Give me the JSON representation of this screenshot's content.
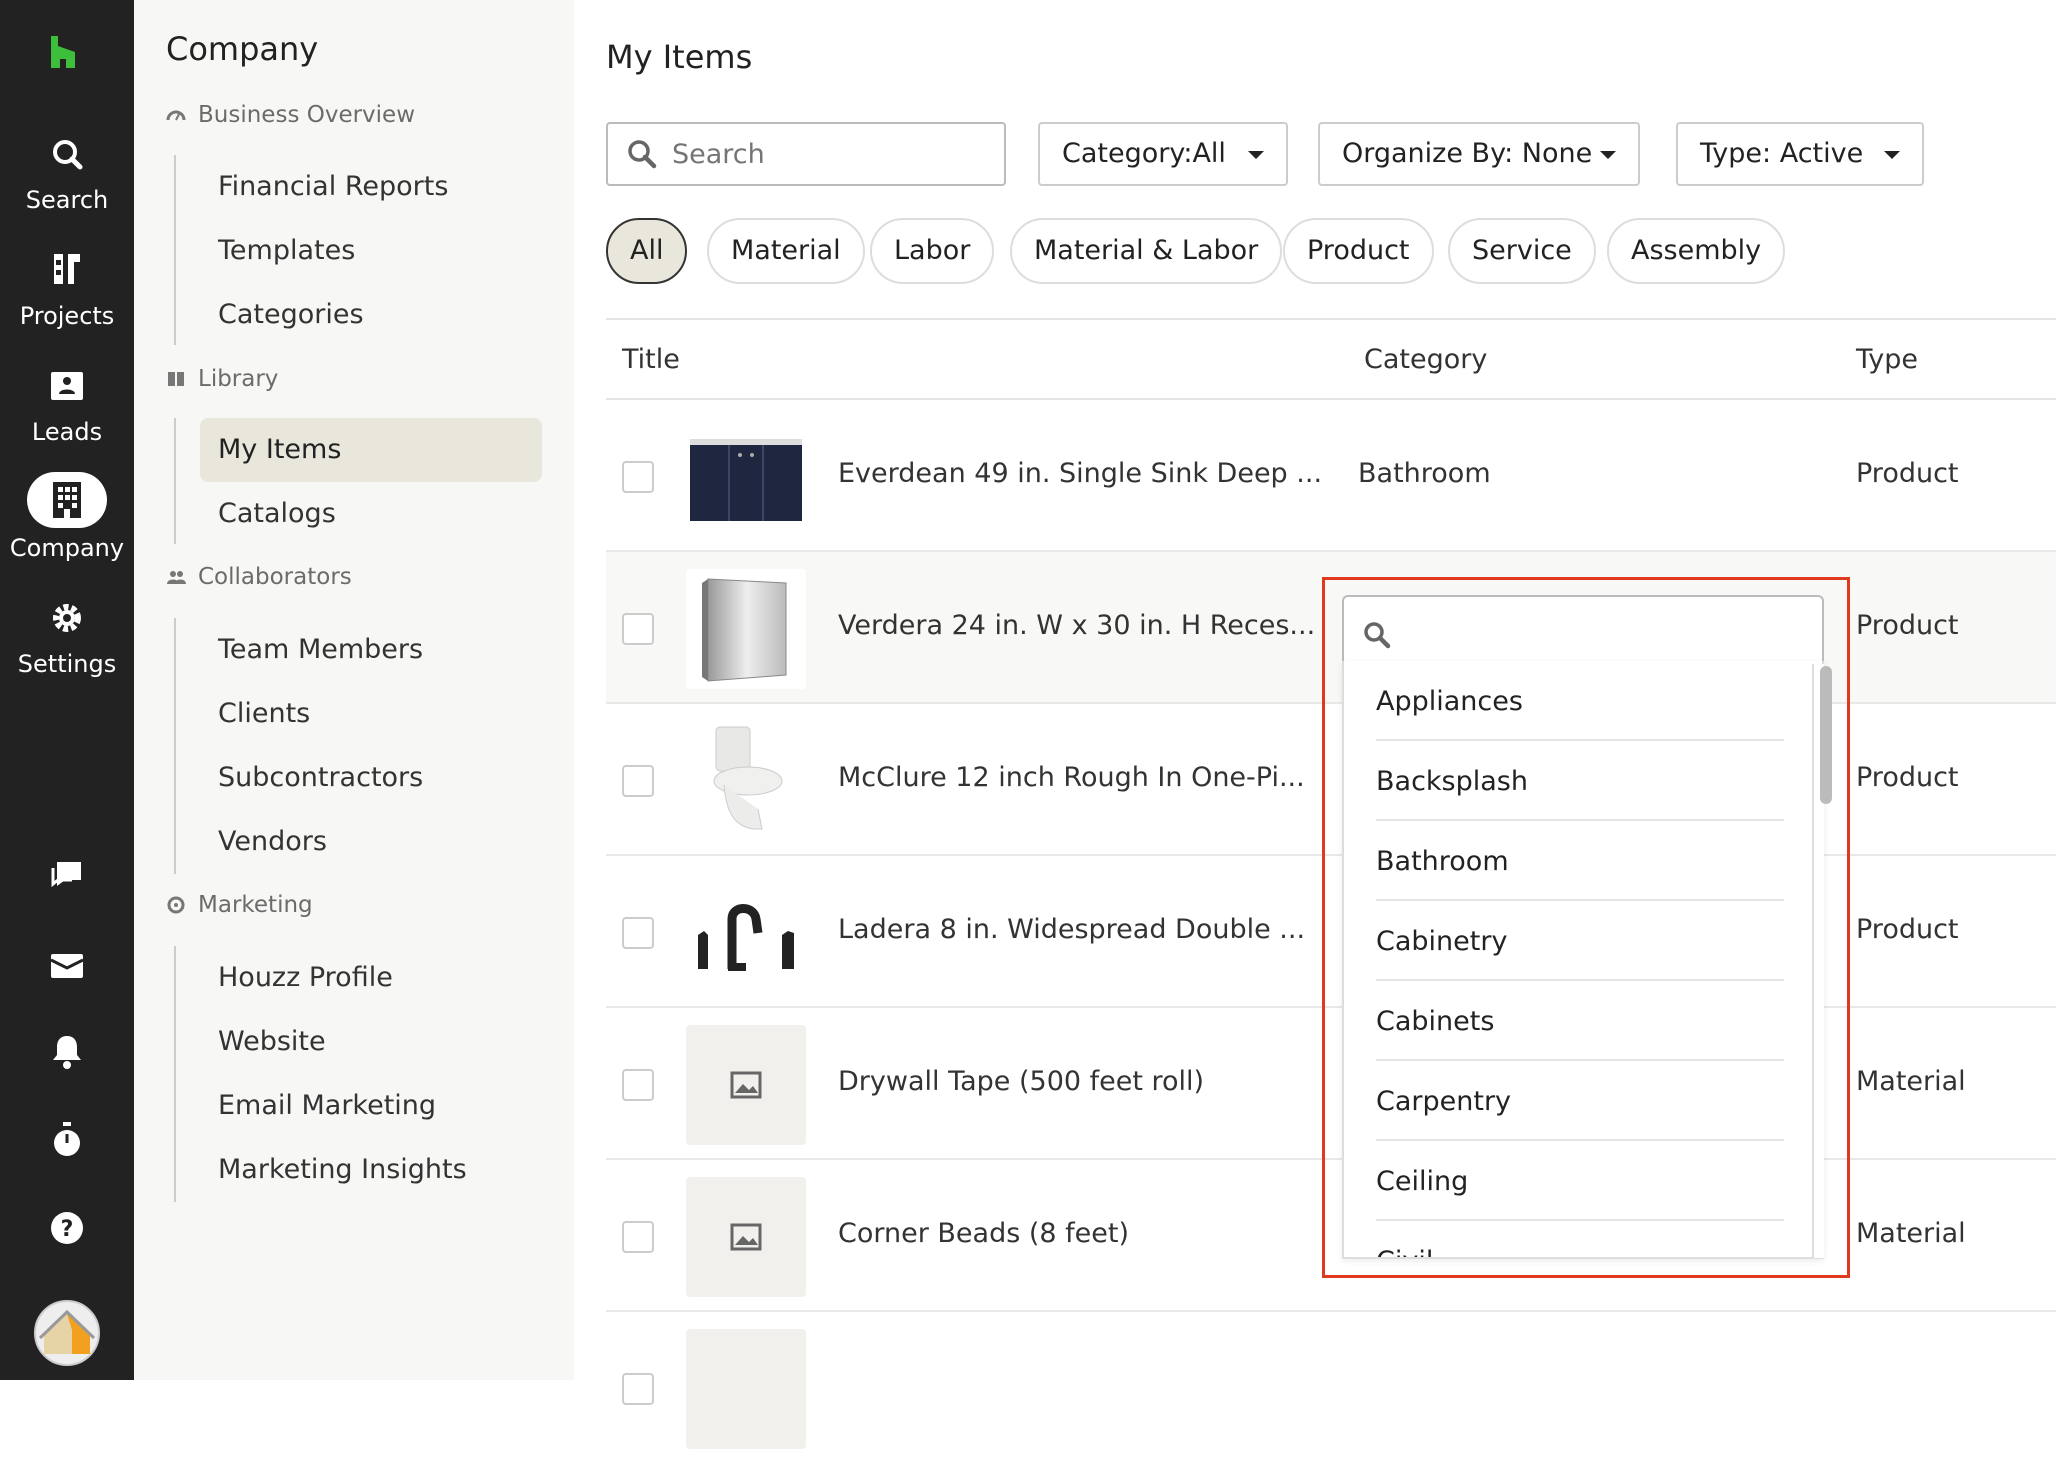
{
  "rail": {
    "items": [
      {
        "label": "Search",
        "icon": "search-icon"
      },
      {
        "label": "Projects",
        "icon": "projects-icon"
      },
      {
        "label": "Leads",
        "icon": "leads-icon"
      },
      {
        "label": "Company",
        "icon": "company-icon"
      },
      {
        "label": "Settings",
        "icon": "gear-icon"
      }
    ],
    "bottom_icons": [
      "chat-icon",
      "inbox-icon",
      "bell-icon",
      "timer-icon",
      "help-icon",
      "avatar"
    ],
    "brand_color": "#3dbf3d"
  },
  "sidenav": {
    "title": "Company",
    "sections": [
      {
        "label": "Business Overview",
        "icon": "dashboard-icon",
        "items": [
          "Financial Reports",
          "Templates",
          "Categories"
        ]
      },
      {
        "label": "Library",
        "icon": "library-icon",
        "items": [
          "My Items",
          "Catalogs"
        ]
      },
      {
        "label": "Collaborators",
        "icon": "people-icon",
        "items": [
          "Team Members",
          "Clients",
          "Subcontractors",
          "Vendors"
        ]
      },
      {
        "label": "Marketing",
        "icon": "marketing-icon",
        "items": [
          "Houzz Profile",
          "Website",
          "Email Marketing",
          "Marketing Insights"
        ]
      }
    ],
    "active_item": "My Items"
  },
  "main": {
    "title": "My Items",
    "search_placeholder": "Search",
    "filters": {
      "category": "Category:All",
      "organize": "Organize By: None",
      "type": "Type: Active"
    },
    "pills": [
      "All",
      "Material",
      "Labor",
      "Material & Labor",
      "Product",
      "Service",
      "Assembly"
    ],
    "active_pill": "All",
    "columns": {
      "title": "Title",
      "category": "Category",
      "type": "Type"
    },
    "rows": [
      {
        "title": "Everdean 49 in. Single Sink Deep ...",
        "category": "Bathroom",
        "type": "Product",
        "thumb": "vanity"
      },
      {
        "title": "Verdera 24 in. W x 30 in. H Reces...",
        "category": "",
        "type": "Product",
        "thumb": "mirror"
      },
      {
        "title": "McClure 12 inch Rough In One-Pi...",
        "category": "",
        "type": "Product",
        "thumb": "toilet"
      },
      {
        "title": "Ladera 8 in. Widespread Double ...",
        "category": "",
        "type": "Product",
        "thumb": "faucet"
      },
      {
        "title": "Drywall Tape (500 feet roll)",
        "category": "",
        "type": "Material",
        "thumb": "placeholder"
      },
      {
        "title": "Corner Beads (8 feet)",
        "category": "",
        "type": "Material",
        "thumb": "placeholder"
      }
    ]
  },
  "category_dropdown": {
    "search_value": "",
    "options": [
      "Appliances",
      "Backsplash",
      "Bathroom",
      "Cabinetry",
      "Cabinets",
      "Carpentry",
      "Ceiling",
      "Civil"
    ],
    "highlight_color": "#e03a1e"
  }
}
